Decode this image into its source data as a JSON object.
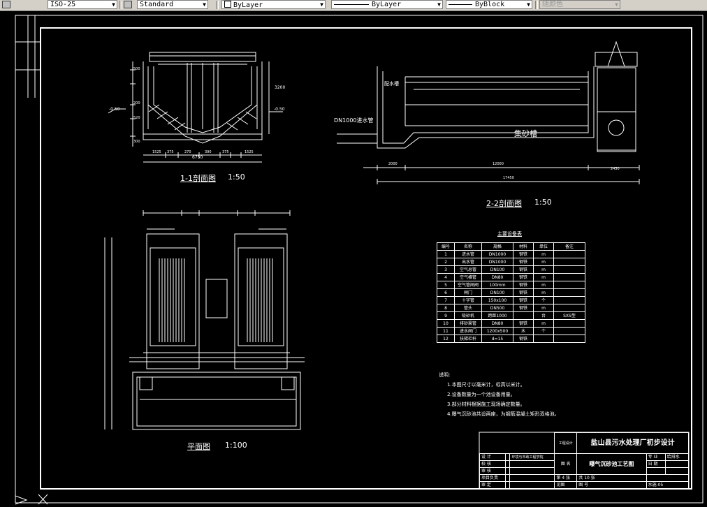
{
  "toolbar": {
    "dimstyle": "ISO-25",
    "tablestyle": "Standard",
    "layer_color": "ByLayer",
    "linetype": "ByLayer",
    "lineweight": "ByBlock",
    "plotstyle": "随颜色"
  },
  "drawing": {
    "section11": {
      "title": "1-1剖面图",
      "scale": "1:50",
      "dims_bottom": [
        "1525",
        "375",
        "270",
        "390",
        "375",
        "1525"
      ],
      "dim_total": "6750",
      "dims_left": [
        "500",
        "200",
        "520",
        "300"
      ],
      "dim_right": "3200",
      "level_left": "-0.50",
      "level_right": "-0.50"
    },
    "section22": {
      "title": "2-2剖面图",
      "scale": "1:50",
      "pipe_label": "DN1000进水管",
      "tank_label": "集砂槽",
      "trough_label": "配水槽",
      "dims": [
        "2000",
        "12000",
        "2450"
      ],
      "dim_total": "17450"
    },
    "plan": {
      "title": "平面图",
      "scale": "1:100"
    },
    "equipment_table": {
      "title": "主要设备表",
      "headers": [
        "编号",
        "名称",
        "规格",
        "材料",
        "单位",
        "备注"
      ],
      "rows": [
        [
          "1",
          "进水管",
          "DN1000",
          "钢铁",
          "m",
          ""
        ],
        [
          "2",
          "出水管",
          "DN1000",
          "钢铁",
          "m",
          ""
        ],
        [
          "3",
          "空气总管",
          "DN100",
          "钢铁",
          "m",
          ""
        ],
        [
          "4",
          "空气横管",
          "DN80",
          "钢铁",
          "m",
          ""
        ],
        [
          "5",
          "空气管闸阀",
          "100mm",
          "钢铁",
          "m",
          ""
        ],
        [
          "6",
          "闸门",
          "DN100",
          "钢铁",
          "m",
          ""
        ],
        [
          "7",
          "十字管",
          "150x100",
          "钢铁",
          "个",
          ""
        ],
        [
          "8",
          "管头",
          "DN500",
          "钢铁",
          "m",
          ""
        ],
        [
          "9",
          "吸砂机",
          "跨距1000",
          "",
          "台",
          "SXS型"
        ],
        [
          "10",
          "排砂渠管",
          "DN80",
          "钢铁",
          "m",
          ""
        ],
        [
          "11",
          "进水闸门",
          "1200x500",
          "木",
          "个",
          ""
        ],
        [
          "12",
          "扶梯栏杆",
          "d=15",
          "钢铁",
          "",
          ""
        ]
      ]
    },
    "notes": {
      "heading": "说明:",
      "items": [
        "1.本图尺寸以毫米计，标高以米计。",
        "2.设备数量为一个池设备用量。",
        "3.部分材料根据施工现场确定数量。",
        "4.曝气沉砂池共设两座，为钢筋混凝土矩形双格池。"
      ]
    },
    "title_block": {
      "company": "工程设计",
      "project": "盐山县污水处理厂初步设计",
      "dept": "环境与市政工程学院",
      "drawing_title": "曝气沉砂池工艺图",
      "major_label": "专 业",
      "major": "给排水",
      "date_label": "日 期",
      "sheet": "第 4 张",
      "total": "共 10 张",
      "scale": "见图",
      "num_label": "图 号",
      "num": "水施-05",
      "roles": [
        "设 计",
        "校 核",
        "审 核",
        "项目负责",
        "审 定"
      ]
    }
  }
}
